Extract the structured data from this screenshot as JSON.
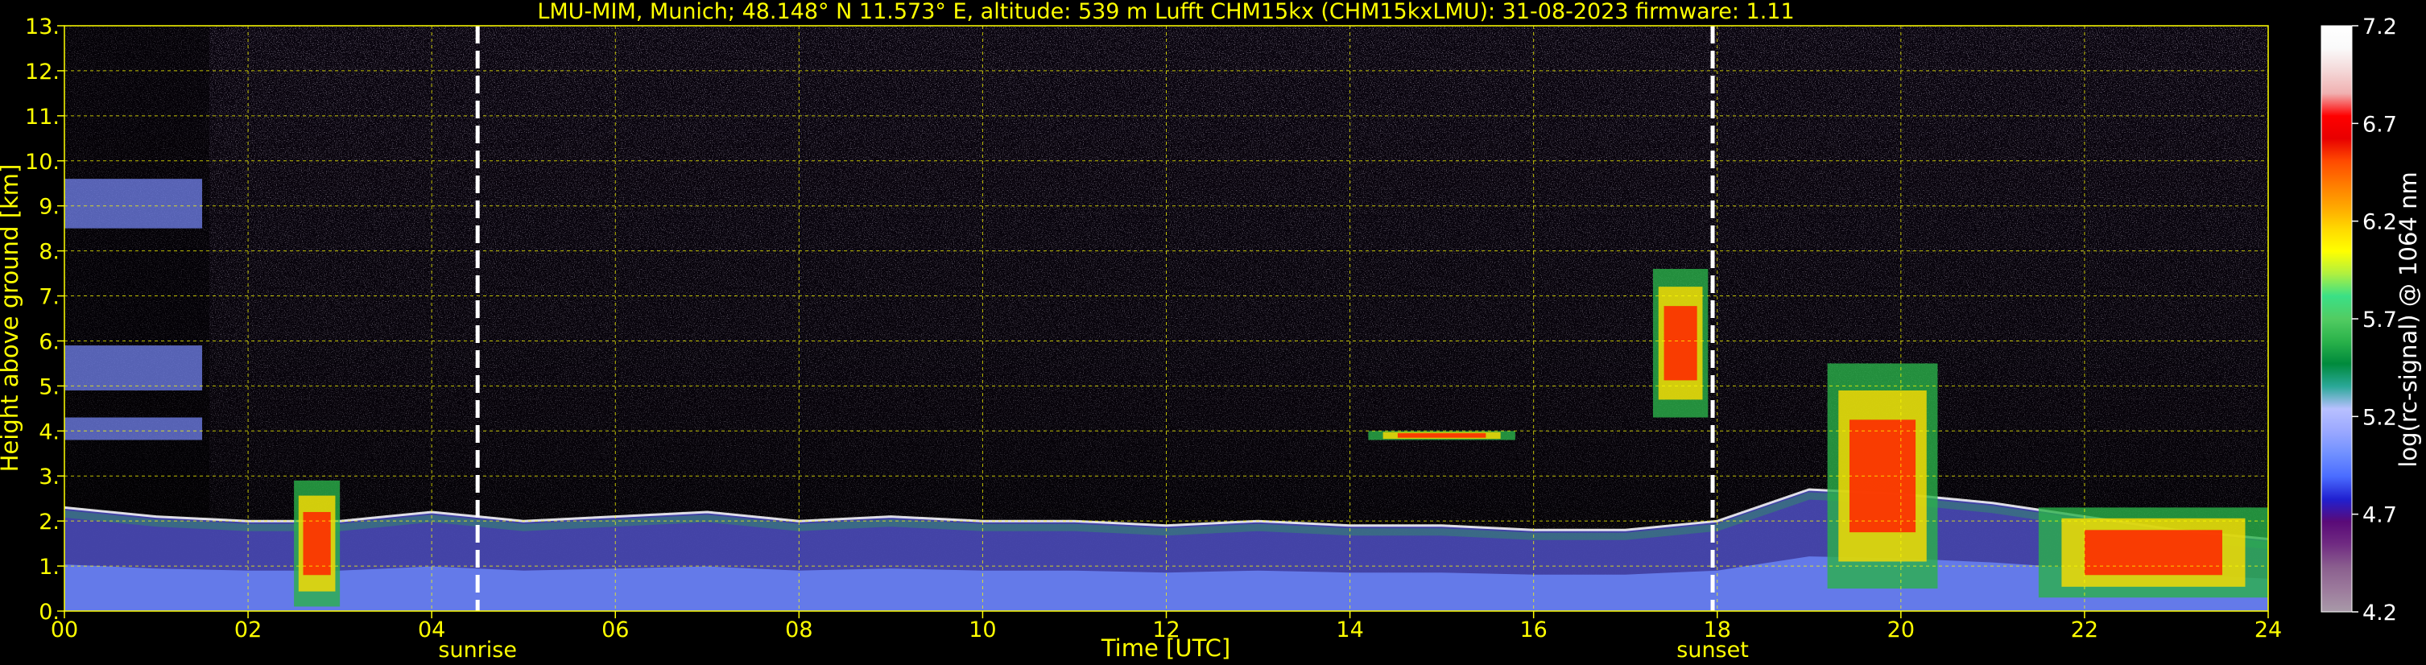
{
  "chart_data": {
    "type": "heatmap",
    "title": "LMU-MIM, Munich; 48.148° N 11.573° E, altitude: 539 m    Lufft CHM15kx (CHM15kxLMU): 31-08-2023    firmware: 1.11",
    "xlabel": "Time [UTC]",
    "ylabel": "Height above ground [km]",
    "xlim": [
      0,
      24
    ],
    "ylim": [
      0,
      13
    ],
    "x_ticks": [
      "00",
      "02",
      "04",
      "06",
      "08",
      "10",
      "12",
      "14",
      "16",
      "18",
      "20",
      "22",
      "24"
    ],
    "y_ticks": [
      "0.",
      "1.",
      "2.",
      "3.",
      "4.",
      "5.",
      "6.",
      "7.",
      "8.",
      "9.",
      "10.",
      "11.",
      "12.",
      "13."
    ],
    "grid": true,
    "colorbar": {
      "label": "log(rc-signal) @ 1064 nm",
      "range": [
        4.2,
        7.2
      ],
      "ticks": [
        "4.2",
        "4.7",
        "5.2",
        "5.7",
        "6.2",
        "6.7",
        "7.2"
      ],
      "colors": [
        "#a89aa8",
        "#9c7a9c",
        "#8a5e8e",
        "#702b82",
        "#5a0a78",
        "#2020d0",
        "#4a6cff",
        "#7090ff",
        "#9aa8ff",
        "#b8c0ff",
        "#2aa898",
        "#008a3c",
        "#2ab24a",
        "#52cc62",
        "#3ae086",
        "#b0f040",
        "#ffff00",
        "#ffd800",
        "#ffa600",
        "#ff7a00",
        "#ff4a00",
        "#e80000",
        "#ff0000",
        "#f0b0b0",
        "#f4d8d8",
        "#fafafa",
        "#ffffff"
      ]
    },
    "annotations": [
      {
        "label": "sunrise",
        "time": 4.5
      },
      {
        "label": "sunset",
        "time": 17.95
      }
    ],
    "features": [
      {
        "kind": "boundary_layer",
        "t_start": 0,
        "t_end": 24,
        "top_km": [
          2.3,
          2.1,
          2.0,
          2.0,
          2.2,
          2.0,
          2.1,
          2.2,
          2.0,
          2.1,
          2.0,
          2.0,
          1.9,
          2.0,
          1.9,
          1.9,
          1.8,
          1.8,
          2.0,
          2.7,
          2.6,
          2.4,
          2.1,
          1.8,
          1.6
        ]
      },
      {
        "kind": "aerosol_layer",
        "t_start": 0,
        "t_end": 1.5,
        "bottom_km": 4.9,
        "top_km": 5.9
      },
      {
        "kind": "aerosol_layer",
        "t_start": 0,
        "t_end": 1.5,
        "bottom_km": 8.5,
        "top_km": 9.6
      },
      {
        "kind": "aerosol_layer",
        "t_start": 0,
        "t_end": 1.5,
        "bottom_km": 3.8,
        "top_km": 4.3
      },
      {
        "kind": "cloud",
        "t_start": 14.2,
        "t_end": 15.8,
        "bottom_km": 3.8,
        "top_km": 4.0
      },
      {
        "kind": "cloud",
        "t_start": 17.3,
        "t_end": 17.9,
        "bottom_km": 4.3,
        "top_km": 7.6
      },
      {
        "kind": "cloud",
        "t_start": 19.2,
        "t_end": 20.4,
        "bottom_km": 0.5,
        "top_km": 5.5
      },
      {
        "kind": "cloud",
        "t_start": 21.5,
        "t_end": 24,
        "bottom_km": 0.3,
        "top_km": 2.3
      },
      {
        "kind": "cloud",
        "t_start": 2.5,
        "t_end": 3.0,
        "bottom_km": 0.1,
        "top_km": 2.9
      }
    ]
  }
}
